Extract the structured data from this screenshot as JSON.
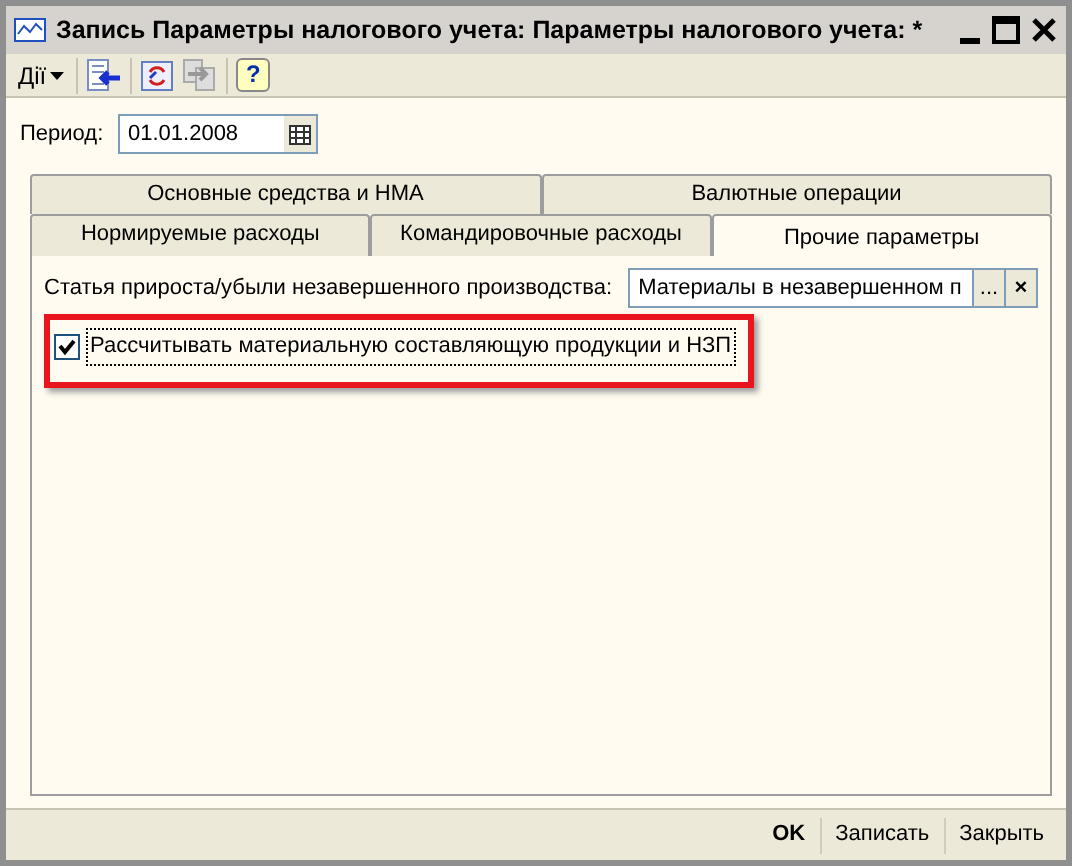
{
  "window": {
    "title": "Запись Параметры налогового учета: Параметры налогового учета: *"
  },
  "toolbar": {
    "actions_menu": "Дії",
    "help": "?"
  },
  "period": {
    "label": "Период:",
    "value": "01.01.2008"
  },
  "tab_rows": [
    [
      {
        "label": "Основные средства и НМА",
        "selected": false
      },
      {
        "label": "Валютные операции",
        "selected": false
      }
    ],
    [
      {
        "label": "Нормируемые расходы",
        "selected": false
      },
      {
        "label": "Командировочные расходы",
        "selected": false
      },
      {
        "label": "Прочие параметры",
        "selected": true
      }
    ]
  ],
  "wip_item": {
    "label": "Статья прироста/убыли незавершенного производства:",
    "value": "Материалы в незавершенном п",
    "select": "...",
    "clear": "×"
  },
  "material_option": {
    "label": "Рассчитывать материальную составляющую продукции и НЗП",
    "checked": true,
    "highlighted": true
  },
  "buttons": [
    {
      "label": "OK",
      "default": true
    },
    {
      "label": "Записать",
      "default": false
    },
    {
      "label": "Закрыть",
      "default": false
    }
  ]
}
